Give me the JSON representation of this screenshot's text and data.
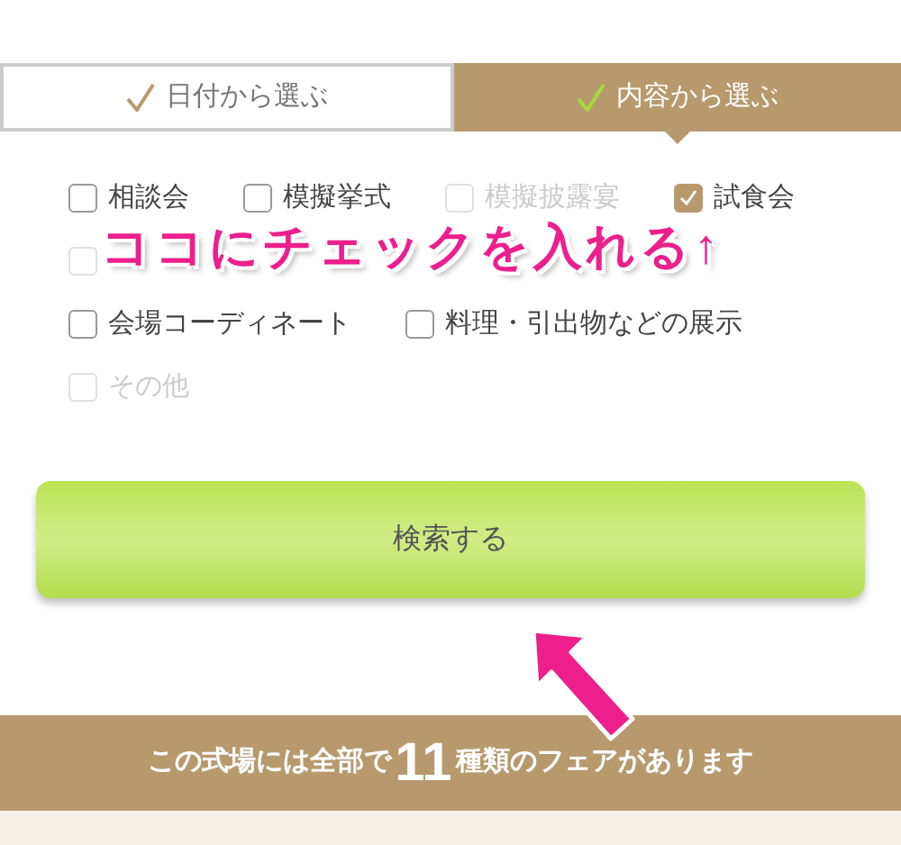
{
  "tabs": [
    {
      "label": "日付から選ぶ",
      "selected": false
    },
    {
      "label": "内容から選ぶ",
      "selected": true
    }
  ],
  "fair_types": [
    {
      "label": "相談会",
      "checked": false,
      "disabled": false
    },
    {
      "label": "模擬挙式",
      "checked": false,
      "disabled": false
    },
    {
      "label": "模擬披露宴",
      "checked": false,
      "disabled": true
    },
    {
      "label": "試食会",
      "checked": true,
      "disabled": false
    },
    {
      "checked": false,
      "disabled": true
    },
    {
      "label": "会場コーディネート",
      "checked": false,
      "disabled": false
    },
    {
      "label": "料理・引出物などの展示",
      "checked": false,
      "disabled": false
    },
    {
      "label": "その他",
      "checked": false,
      "disabled": true
    }
  ],
  "annotation": {
    "text": "ココにチェックを入れる↑"
  },
  "search_button": {
    "label": "検索する"
  },
  "summary": {
    "prefix": "この式場には全部で",
    "count": "11",
    "suffix": "種類のフェアがあります"
  }
}
